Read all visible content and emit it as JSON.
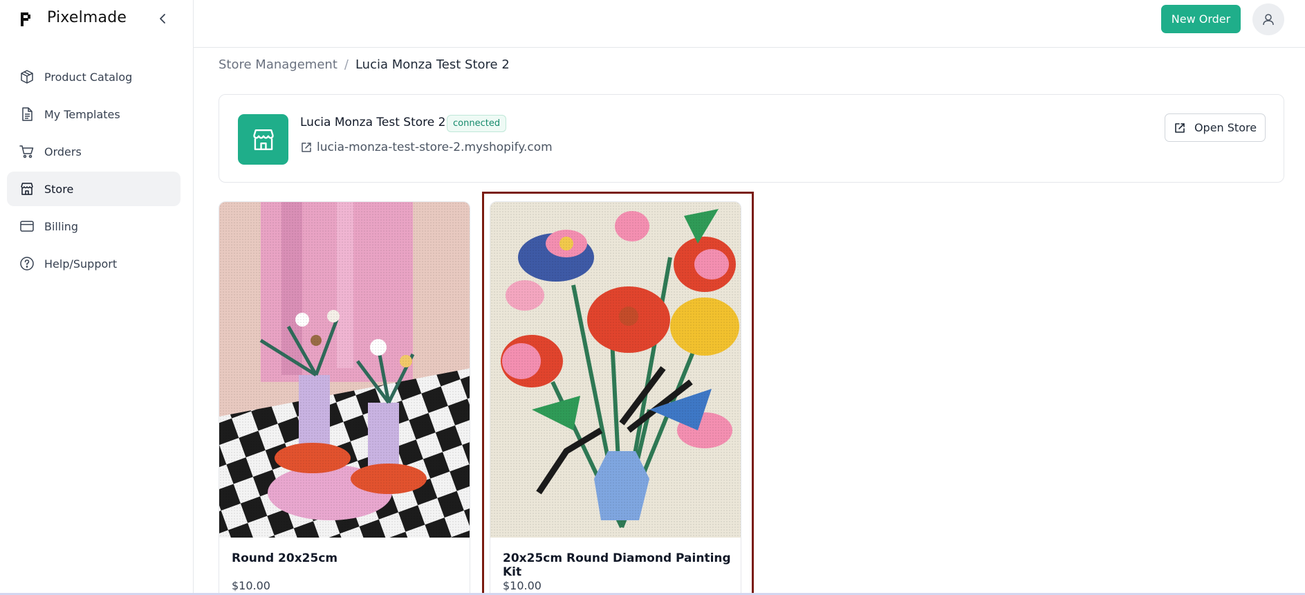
{
  "app": {
    "name": "Pixelmade"
  },
  "sidebar": {
    "items": [
      {
        "label": "Product Catalog",
        "icon": "box-icon",
        "active": false
      },
      {
        "label": "My Templates",
        "icon": "document-icon",
        "active": false
      },
      {
        "label": "Orders",
        "icon": "cart-icon",
        "active": false
      },
      {
        "label": "Store",
        "icon": "store-icon",
        "active": true
      },
      {
        "label": "Billing",
        "icon": "credit-card-icon",
        "active": false
      },
      {
        "label": "Help/Support",
        "icon": "help-circle-icon",
        "active": false
      }
    ]
  },
  "header": {
    "new_order_label": "New Order",
    "accent": "#1fae8a"
  },
  "breadcrumb": {
    "parent": "Store Management",
    "separator": "/",
    "current": "Lucia Monza Test Store 2"
  },
  "store": {
    "name": "Lucia Monza Test Store 2",
    "status": "connected",
    "url": "lucia-monza-test-store-2.myshopify.com",
    "open_label": "Open Store"
  },
  "products": [
    {
      "title": "Round 20x25cm",
      "price": "$10.00"
    },
    {
      "title": "20x25cm Round Diamond Painting Kit",
      "price": "$10.00"
    }
  ]
}
